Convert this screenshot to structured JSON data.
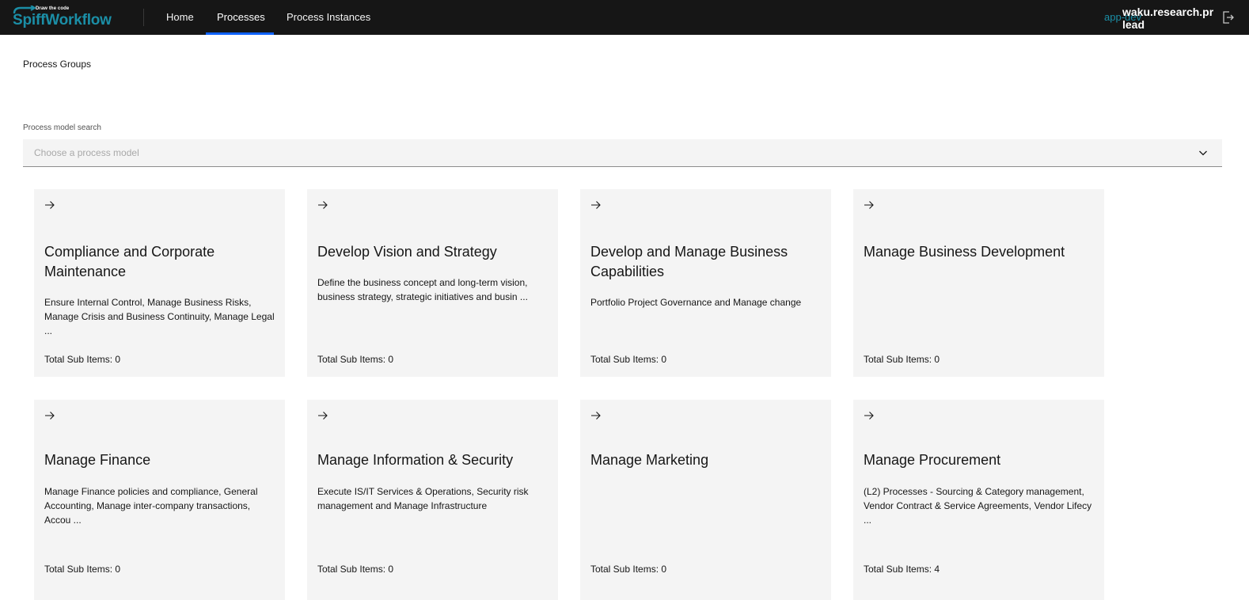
{
  "header": {
    "logo_tagline": "Draw the code",
    "logo_text": "SpiffWorkflow",
    "nav": [
      {
        "label": "Home"
      },
      {
        "label": "Processes"
      },
      {
        "label": "Process Instances"
      }
    ],
    "active_nav": "Processes",
    "user": {
      "role": "app-dev",
      "name": "waku.research.pr",
      "group": "lead"
    }
  },
  "breadcrumb": "Process Groups",
  "search": {
    "label": "Process model search",
    "placeholder": "Choose a process model"
  },
  "cards": [
    {
      "title": "Compliance and Corporate Maintenance",
      "description": "Ensure Internal Control, Manage Business Risks, Manage Crisis and Business Continuity, Manage Legal ...",
      "count": "Total Sub Items: 0"
    },
    {
      "title": "Develop Vision and Strategy",
      "description": "Define the business concept and long-term vision, business strategy, strategic initiatives and busin ...",
      "count": "Total Sub Items: 0"
    },
    {
      "title": "Develop and Manage Business Capabilities",
      "description": "Portfolio Project Governance and Manage change",
      "count": "Total Sub Items: 0"
    },
    {
      "title": "Manage Business Development",
      "description": "",
      "count": "Total Sub Items: 0"
    },
    {
      "title": "Manage Finance",
      "description": "Manage Finance policies and compliance, General Accounting, Manage inter-company transactions, Accou ...",
      "count": "Total Sub Items: 0"
    },
    {
      "title": "Manage Information & Security",
      "description": "Execute IS/IT Services & Operations, Security risk management and Manage Infrastructure",
      "count": "Total Sub Items: 0"
    },
    {
      "title": "Manage Marketing",
      "description": "",
      "count": "Total Sub Items: 0"
    },
    {
      "title": "Manage Procurement",
      "description": "(L2) Processes - Sourcing & Category management, Vendor Contract & Service Agreements, Vendor Lifecy ...",
      "count": "Total Sub Items: 4"
    }
  ],
  "icons": {
    "card_arrow": "arrow-right-icon",
    "search_chevron": "chevron-down-icon",
    "logout": "logout-icon"
  },
  "colors": {
    "header_bg": "#161616",
    "accent": "#0f62fe",
    "brand": "#1b8ea6",
    "card_bg": "#f4f4f4"
  }
}
